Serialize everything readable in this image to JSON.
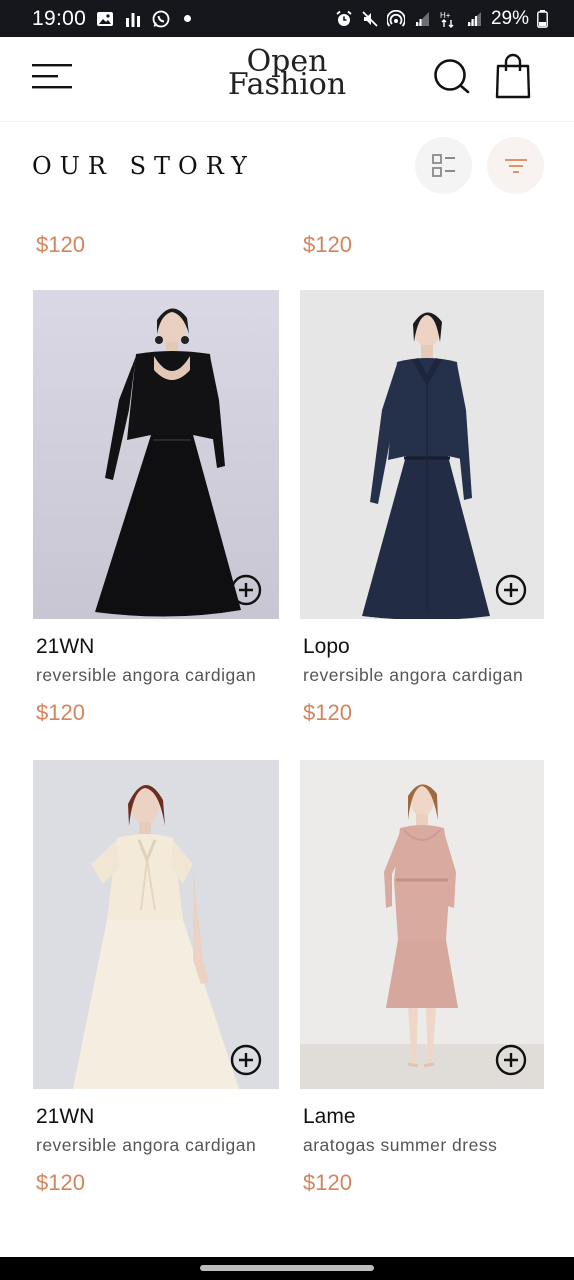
{
  "status_bar": {
    "time": "19:00",
    "battery": "29%",
    "icons": [
      "image-icon",
      "signal-bars-icon",
      "whatsapp-icon",
      "dot-icon",
      "alarm-icon",
      "mute-icon",
      "hotspot-icon",
      "signal-icon",
      "data-icon",
      "signal-icon",
      "battery-icon"
    ]
  },
  "header": {
    "logo_line1": "Open",
    "logo_line2": "Fashion",
    "icons": [
      "menu-icon",
      "search-icon",
      "shopping-bag-icon"
    ]
  },
  "title_bar": {
    "title": "OUR STORY",
    "icons": [
      "list-view-icon",
      "filter-icon"
    ]
  },
  "partial_row": {
    "prices": [
      "$120",
      "$120"
    ]
  },
  "products": [
    {
      "name": "21WN",
      "description": "reversible angora cardigan",
      "price": "$120",
      "image": "black-dress-photo"
    },
    {
      "name": "Lopo",
      "description": "reversible angora cardigan",
      "price": "$120",
      "image": "navy-coat-dress-photo"
    },
    {
      "name": "21WN",
      "description": "reversible angora cardigan",
      "price": "$120",
      "image": "cream-dress-photo"
    },
    {
      "name": "Lame",
      "description": "aratogas summer dress",
      "price": "$120",
      "image": "pink-dress-photo"
    }
  ],
  "colors": {
    "accent": "#d4845c",
    "status_bar": "#15171c",
    "filter_tint": "#f8f3f0"
  }
}
